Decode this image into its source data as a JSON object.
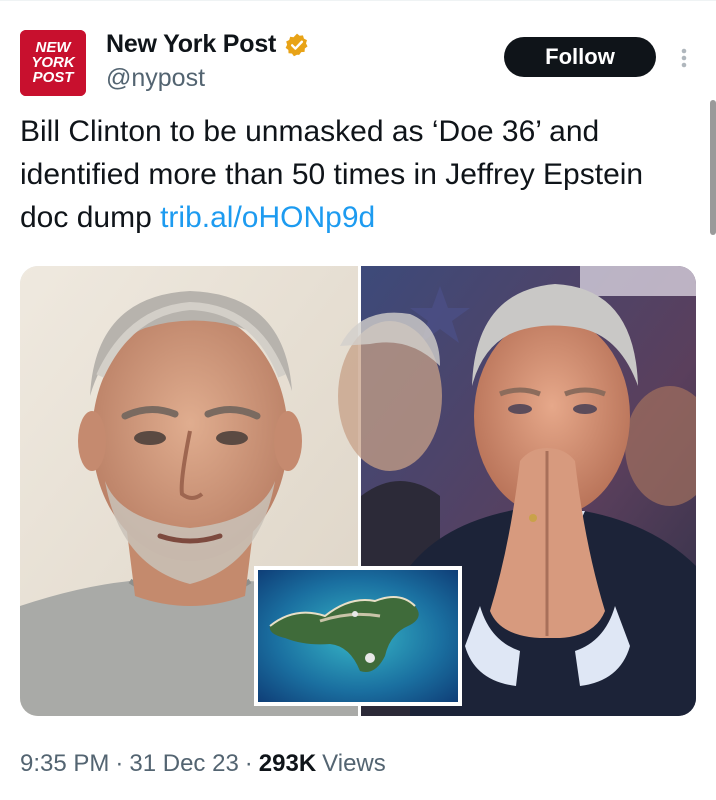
{
  "account": {
    "display_name": "New York Post",
    "handle": "@nypost",
    "avatar_logo_text": [
      "NEW",
      "YORK",
      "POST"
    ],
    "verified": true
  },
  "actions": {
    "follow_label": "Follow",
    "more_icon": "vertical-ellipsis-icon"
  },
  "tweet": {
    "text": "Bill Clinton to be unmasked as ‘Doe 36’ and identified more than 50 times in Jeffrey Epstein doc dump ",
    "link": "trib.al/oHONp9d"
  },
  "media": {
    "type": "image",
    "panels": [
      "portrait-left",
      "portrait-right",
      "island-inset"
    ]
  },
  "meta": {
    "time": "9:35 PM",
    "date": "31 Dec 23",
    "views_count": "293K",
    "views_label": "Views",
    "separator": "·"
  },
  "colors": {
    "brand_red": "#c8102e",
    "verified_gold": "#e8a317",
    "link_blue": "#1d9bf0",
    "text": "#0f1419",
    "secondary_text": "#536471"
  }
}
